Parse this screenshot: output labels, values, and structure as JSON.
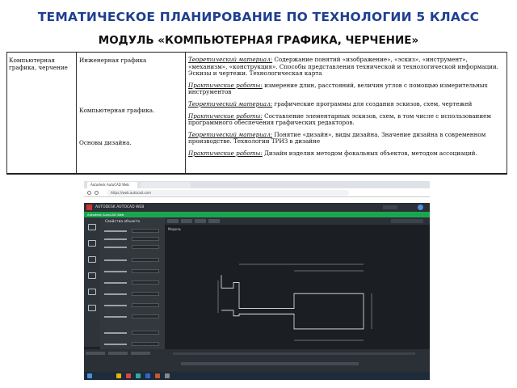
{
  "header": {
    "title": "ТЕМАТИЧЕСКОЕ ПЛАНИРОВАНИЕ ПО ТЕХНОЛОГИИ 5 КЛАСС",
    "subtitle": "МОДУЛЬ «КОМПЬЮТЕРНАЯ ГРАФИКА, ЧЕРЧЕНИЕ»"
  },
  "table": {
    "module": "Компьютерная графика, черчение",
    "rows": [
      {
        "topic": "Инженерная графика",
        "theory_label": "Теоретический материал:",
        "theory_text": "Содержание понятий «изображение», «эскиз», «инструмент», «механизм», «конструкция». Способы представления технической и технологической информации. Эскизы и чертежи. Технологическая карта",
        "practice_label": "Практические работы:",
        "practice_text": "измерение длин, расстояний, величин углов с помощью измерительных инструментов"
      },
      {
        "topic": "Компьютерная графика.",
        "theory_label": "Теоретический материал:",
        "theory_text": "графические программы для создания эскизов, схем, чертежей",
        "practice_label": "Практические работы:",
        "practice_text": "Составление элементарных эскизов, схем, в том числе с использованием программного обеспечения графических редакторов."
      },
      {
        "topic": "Основы дизайна.",
        "theory_label": "Теоретический материал:",
        "theory_text": "Понятие «дизайн», виды дизайна. Значение дизайна в современном производстве. Технологии ТРИЗ в дизайне",
        "practice_label": "Практические работы:",
        "practice_text": "Дизайн изделия методом фокальных объектов, методом ассоциаций."
      }
    ]
  },
  "screenshot": {
    "tab1": "Autodesk AutoCAD Web",
    "address": "https://web.autocad.com",
    "app_name": "AUTODESK AUTOCAD WEB",
    "banner": "Autodesk AutoCAD Web",
    "panel_title": "Свойства объекта",
    "model_label": "Модель"
  },
  "colors": {
    "title_blue": "#1f3f92",
    "banner_green": "#19a74e",
    "cad_background": "#1b1f24"
  }
}
